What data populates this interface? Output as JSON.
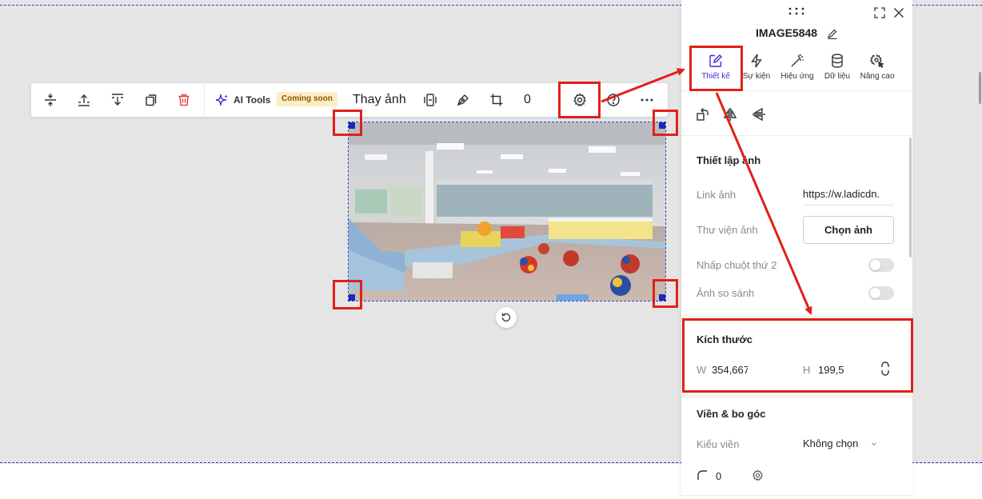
{
  "toolbar": {
    "ai_tools_label": "AI Tools",
    "coming_soon_label": "Coming soon",
    "replace_image_label": "Thay ảnh",
    "counter_value": "0"
  },
  "panel": {
    "element_title": "IMAGE5848",
    "tabs": [
      {
        "label": "Thiết kế",
        "icon": "edit-square-icon",
        "active": true
      },
      {
        "label": "Sự kiện",
        "icon": "lightning-icon",
        "active": false
      },
      {
        "label": "Hiệu ứng",
        "icon": "magic-wand-icon",
        "active": false
      },
      {
        "label": "Dữ liệu",
        "icon": "database-icon",
        "active": false
      },
      {
        "label": "Nâng cao",
        "icon": "gear-cursor-icon",
        "active": false
      }
    ],
    "image_settings": {
      "title": "Thiết lập ảnh",
      "link_label": "Link ảnh",
      "link_value": "https://w.ladicdn.",
      "library_label": "Thư viện ảnh",
      "choose_button": "Chọn ảnh",
      "second_click_label": "Nhấp chuột thứ 2",
      "second_click_on": false,
      "compare_label": "Ảnh so sánh",
      "compare_on": false
    },
    "size": {
      "title": "Kích thước",
      "w_label": "W",
      "w_value": "354,667",
      "h_label": "H",
      "h_value": "199,5"
    },
    "border": {
      "title": "Viền & bo góc",
      "style_label": "Kiểu viền",
      "style_value": "Không chọn",
      "radius_value": "0"
    }
  },
  "colors": {
    "accent": "#3b2bd6",
    "annotation_red": "#e0201a",
    "selection_blue": "#1a2bb8",
    "canvas_bg": "#e5e5e5"
  }
}
